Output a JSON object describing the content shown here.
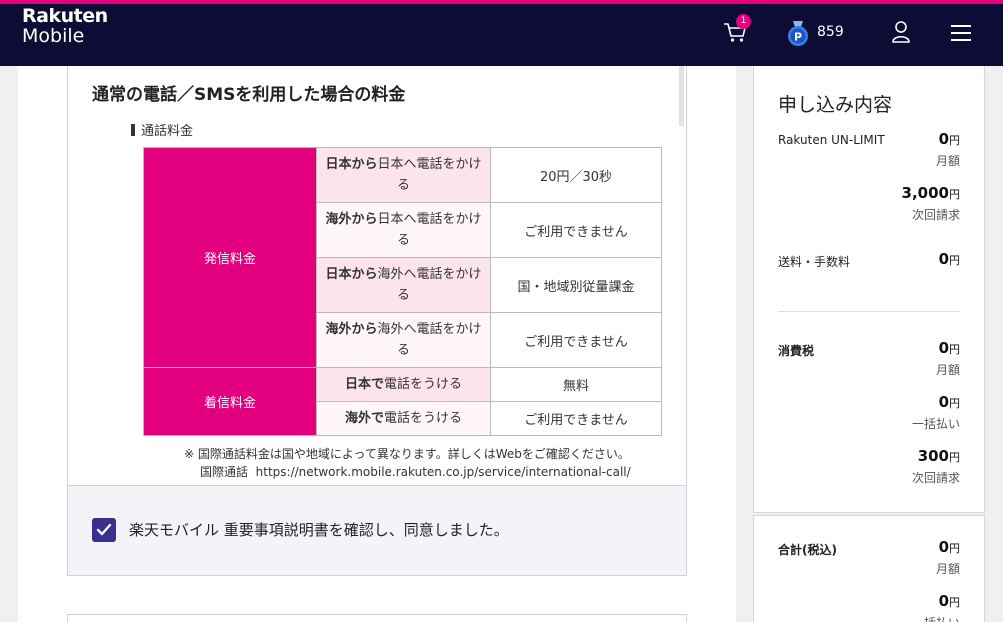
{
  "header": {
    "logo_line1": "Rakuten",
    "logo_line2": "Mobile",
    "cart_count": "1",
    "points": "859"
  },
  "call_section": {
    "title": "通常の電話／SMSを利用した場合の料金",
    "subtitle": "通話料金",
    "outgoing_label": "発信料金",
    "incoming_label": "着信料金",
    "rows": [
      {
        "label_bold": "日本から",
        "label_rest": "日本へ電話をかける",
        "value": "20円／30秒"
      },
      {
        "label_bold": "海外から",
        "label_rest": "日本へ電話をかける",
        "value": "ご利用できません"
      },
      {
        "label_bold": "日本から",
        "label_rest": "海外へ電話をかける",
        "value": "国・地域別従量課金"
      },
      {
        "label_bold": "海外から",
        "label_rest": "海外へ電話をかける",
        "value": "ご利用できません"
      },
      {
        "label_bold": "日本で",
        "label_rest": "電話をうける",
        "value": "無料"
      },
      {
        "label_bold": "海外で",
        "label_rest": "電話をうける",
        "value": "ご利用できません"
      }
    ],
    "note": "※ 国際通話料金は国や地域によって異なります。詳しくはWebをご確認ください。",
    "link_label": "国際通話",
    "link_url": "https://network.mobile.rakuten.co.jp/service/international-call/"
  },
  "agreement": {
    "checked": true,
    "text": "楽天モバイル 重要事項説明書を確認し、同意しました。"
  },
  "summary": {
    "title": "申し込み内容",
    "yen": "円",
    "plan_label": "Rakuten UN-LIMIT",
    "plan_monthly": "0",
    "monthly": "月額",
    "plan_next": "3,000",
    "next_bill": "次回請求",
    "fee_label": "送料・手数料",
    "fee_amount": "0",
    "tax_label": "消費税",
    "tax_monthly": "0",
    "tax_lump": "0",
    "lump_sum": "一括払い",
    "tax_next": "300",
    "total_label": "合計(税込)",
    "total_monthly": "0",
    "total_lump": "0"
  }
}
